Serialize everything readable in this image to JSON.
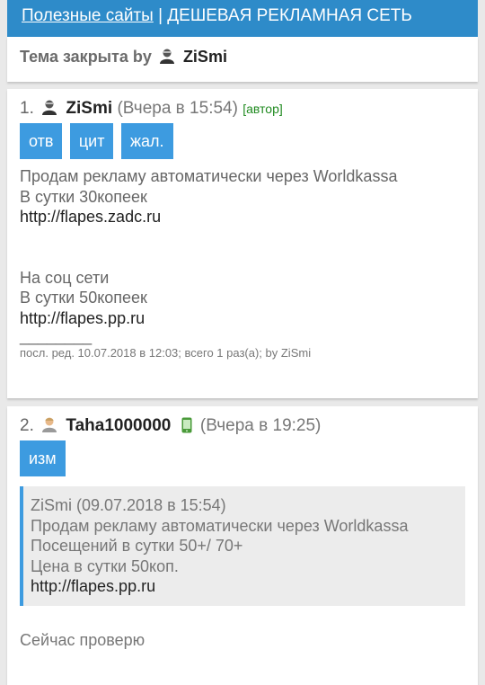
{
  "header": {
    "link_text": "Полезные сайты",
    "separator": "|",
    "title": "ДЕШЕВАЯ РЕКЛАМНАЯ СЕТЬ"
  },
  "closed_notice": {
    "text": "Тема закрыта by",
    "user": "ZiSmi"
  },
  "posts": [
    {
      "number": "1.",
      "user": "ZiSmi",
      "date": "(Вчера в 15:54)",
      "badge": "[автор]",
      "buttons": [
        "отв",
        "цит",
        "жал."
      ],
      "lines": [
        "Продам рекламу автоматически через Worldkassa",
        "В сутки 30копеек",
        "http://flapes.zadc.ru",
        "На соц сети",
        "В сутки 50копеек",
        "http://flapes.pp.ru"
      ],
      "separator": "________",
      "edited": "посл. ред. 10.07.2018 в 12:03; всего 1 раз(а); by ZiSmi"
    },
    {
      "number": "2.",
      "user": "Taha1000000",
      "date": "(Вчера в 19:25)",
      "buttons": [
        "изм"
      ],
      "quote": {
        "header": "ZiSmi (09.07.2018 в 15:54)",
        "lines": [
          "Продам рекламу автоматически через Worldkassa",
          "Посещений в сутки 50+/ 70+",
          "Цена в сутки 50коп.",
          "http://flapes.pp.ru"
        ]
      },
      "reply": "Сейчас проверю"
    }
  ],
  "colors": {
    "header_bg": "#2e8bc9",
    "button_bg": "#3d9be0",
    "author_badge": "#1f8a1f",
    "quote_bg": "#ececec"
  },
  "icons": {
    "user_avatar": "avatar-icon",
    "online_status": "mobile-phone-icon"
  }
}
